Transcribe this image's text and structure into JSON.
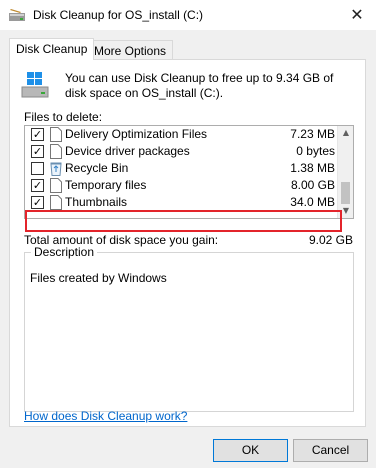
{
  "window": {
    "title": "Disk Cleanup for OS_install (C:)"
  },
  "tabs": [
    {
      "label": "Disk Cleanup",
      "active": true
    },
    {
      "label": "More Options",
      "active": false
    }
  ],
  "intro_text": "You can use Disk Cleanup to free up to 9.34 GB of disk space on OS_install (C:).",
  "files_label": "Files to delete:",
  "files": [
    {
      "name": "Delivery Optimization Files",
      "size": "7.23 MB",
      "checked": true,
      "icon": "file-icon"
    },
    {
      "name": "Device driver packages",
      "size": "0 bytes",
      "checked": true,
      "icon": "file-icon"
    },
    {
      "name": "Recycle Bin",
      "size": "1.38 MB",
      "checked": false,
      "icon": "recycle-bin-icon"
    },
    {
      "name": "Temporary files",
      "size": "8.00 GB",
      "checked": true,
      "icon": "file-icon",
      "highlighted": true
    },
    {
      "name": "Thumbnails",
      "size": "34.0 MB",
      "checked": true,
      "icon": "file-icon"
    }
  ],
  "total_label": "Total amount of disk space you gain:",
  "total_value": "9.02 GB",
  "description": {
    "legend": "Description",
    "text": "Files created by Windows"
  },
  "help_link": "How does Disk Cleanup work?",
  "buttons": {
    "ok": "OK",
    "cancel": "Cancel"
  },
  "close_glyph": "✕",
  "check_glyph": "✓",
  "colors": {
    "highlight": "#e3242b",
    "link": "#0066cc",
    "ok_border": "#0078d7"
  }
}
